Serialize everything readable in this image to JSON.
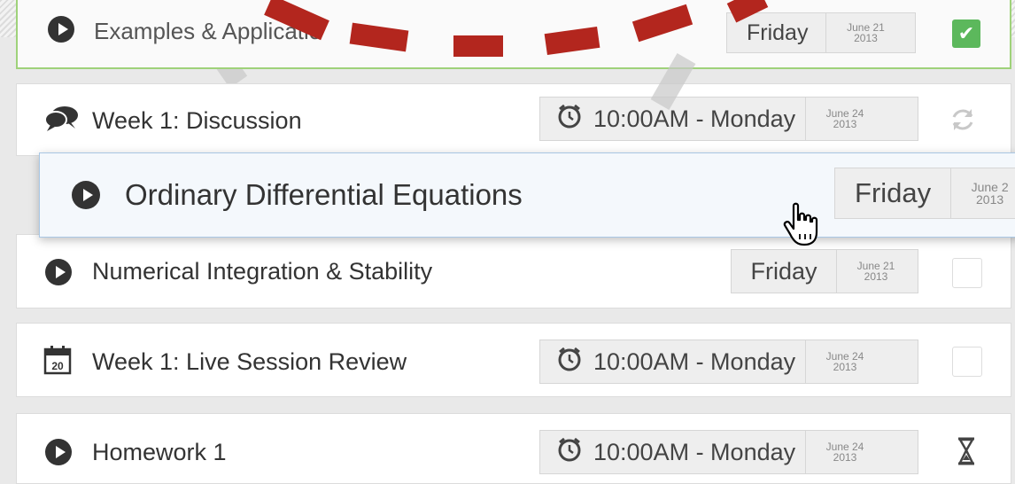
{
  "colors": {
    "dash_red": "#b3261e",
    "complete_green": "#5cb85c",
    "drag_border": "#a9c7e4"
  },
  "rows": [
    {
      "title": "Examples & Applicatio",
      "icon": "play-icon",
      "due_time": "Friday",
      "date_month": "June 21",
      "date_year": "2013",
      "status": "check-complete-icon"
    },
    {
      "title": "Week 1: Discussion",
      "icon": "speech-bubbles-icon",
      "due_time": "10:00AM - Monday",
      "date_month": "June 24",
      "date_year": "2013",
      "status": "refresh-icon"
    },
    {
      "title": "Numerical Integration & Stability",
      "icon": "play-icon",
      "due_time": "Friday",
      "date_month": "June 21",
      "date_year": "2013",
      "status": "empty-checkbox"
    },
    {
      "title": "Week 1: Live Session Review",
      "icon": "calendar-icon",
      "calendar_day": "20",
      "due_time": "10:00AM - Monday",
      "date_month": "June 24",
      "date_year": "2013",
      "status": "empty-checkbox"
    },
    {
      "title": "Homework 1",
      "icon": "play-icon",
      "due_time": "10:00AM - Monday",
      "date_month": "June 24",
      "date_year": "2013",
      "status": "hourglass-icon"
    }
  ],
  "dragging": {
    "title": "Ordinary Differential Equations",
    "icon": "play-icon",
    "due_time": "Friday",
    "date_month": "June 2",
    "date_year": "2013",
    "cursor": "hand-pointer-icon"
  }
}
